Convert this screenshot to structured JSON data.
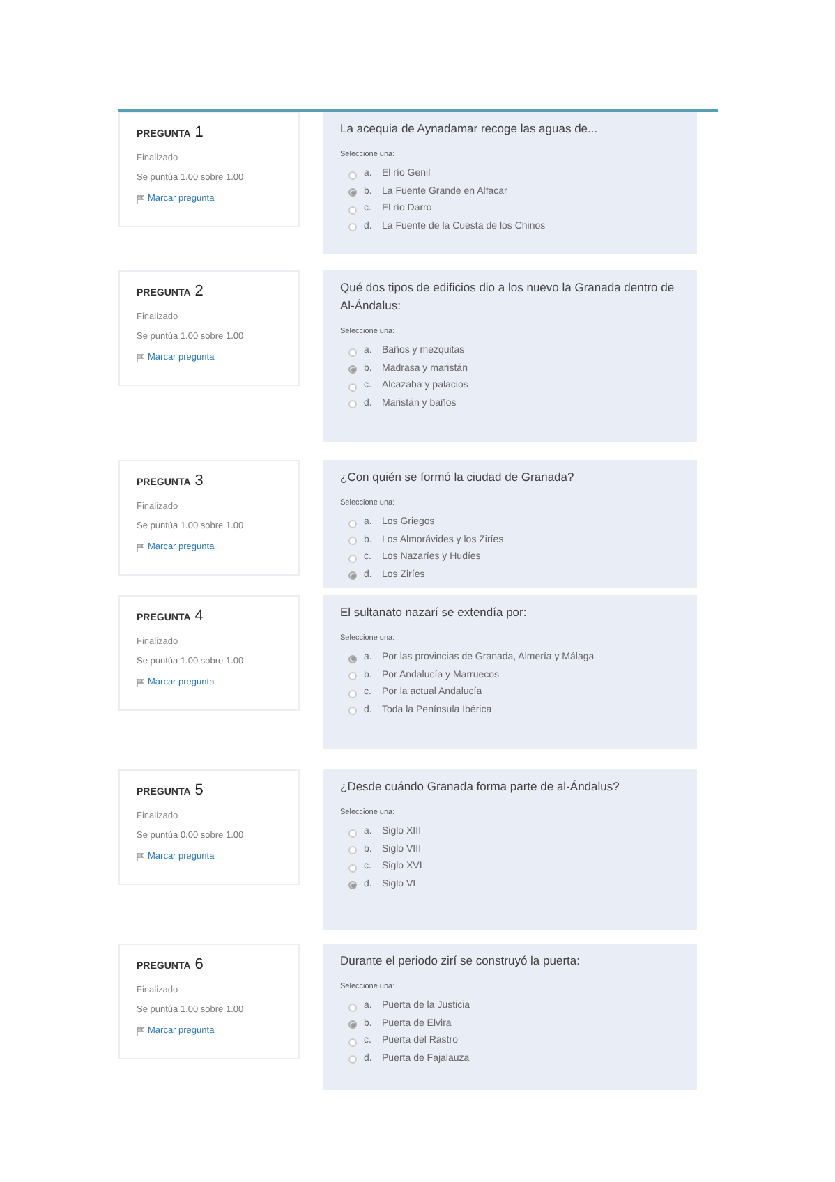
{
  "questions": [
    {
      "label": "PREGUNTA",
      "number": "1",
      "state": "Finalizado",
      "score": "Se puntúa 1.00 sobre 1.00",
      "flag": "Marcar pregunta",
      "prompt": "La acequia de Aynadamar recoge las aguas de...",
      "instruction": "Seleccione una:",
      "options": [
        {
          "letter": "a.",
          "text": "El río Genil",
          "selected": false
        },
        {
          "letter": "b.",
          "text": "La Fuente Grande en Alfacar",
          "selected": true
        },
        {
          "letter": "c.",
          "text": "El río Darro",
          "selected": false
        },
        {
          "letter": "d.",
          "text": "La Fuente de la Cuesta de los Chinos",
          "selected": false
        }
      ]
    },
    {
      "label": "PREGUNTA",
      "number": "2",
      "state": "Finalizado",
      "score": "Se puntúa 1.00 sobre 1.00",
      "flag": "Marcar pregunta",
      "prompt": "Qué dos tipos de edificios dio a los nuevo la Granada dentro de Al-Ándalus:",
      "instruction": "Seleccione una:",
      "options": [
        {
          "letter": "a.",
          "text": "Baños y mezquitas",
          "selected": false
        },
        {
          "letter": "b.",
          "text": "Madrasa y maristán",
          "selected": true
        },
        {
          "letter": "c.",
          "text": "Alcazaba y palacios",
          "selected": false
        },
        {
          "letter": "d.",
          "text": "Maristán y baños",
          "selected": false
        }
      ]
    },
    {
      "label": "PREGUNTA",
      "number": "3",
      "state": "Finalizado",
      "score": "Se puntúa 1.00 sobre 1.00",
      "flag": "Marcar pregunta",
      "prompt": "¿Con quién se formó la ciudad de Granada?",
      "instruction": "Seleccione una:",
      "options": [
        {
          "letter": "a.",
          "text": "Los Griegos",
          "selected": false
        },
        {
          "letter": "b.",
          "text": "Los Almorávides y los Ziríes",
          "selected": false
        },
        {
          "letter": "c.",
          "text": "Los Nazaríes y Hudíes",
          "selected": false
        },
        {
          "letter": "d.",
          "text": "Los Ziríes",
          "selected": true
        }
      ]
    },
    {
      "label": "PREGUNTA",
      "number": "4",
      "state": "Finalizado",
      "score": "Se puntúa 1.00 sobre 1.00",
      "flag": "Marcar pregunta",
      "prompt": "El sultanato nazarí se extendía por:",
      "instruction": "Seleccione una:",
      "options": [
        {
          "letter": "a.",
          "text": "Por las provincias de Granada, Almería y Málaga",
          "selected": true
        },
        {
          "letter": "b.",
          "text": "Por Andalucía y Marruecos",
          "selected": false
        },
        {
          "letter": "c.",
          "text": "Por la actual Andalucía",
          "selected": false
        },
        {
          "letter": "d.",
          "text": "Toda la Península Ibérica",
          "selected": false
        }
      ]
    },
    {
      "label": "PREGUNTA",
      "number": "5",
      "state": "Finalizado",
      "score": "Se puntúa 0.00 sobre 1.00",
      "flag": "Marcar pregunta",
      "prompt": "¿Desde cuándo Granada forma parte de al-Ándalus?",
      "instruction": "Seleccione una:",
      "options": [
        {
          "letter": "a.",
          "text": "Siglo XIII",
          "selected": false
        },
        {
          "letter": "b.",
          "text": "Siglo VIII",
          "selected": false
        },
        {
          "letter": "c.",
          "text": "Siglo XVI",
          "selected": false
        },
        {
          "letter": "d.",
          "text": "Siglo VI",
          "selected": true
        }
      ]
    },
    {
      "label": "PREGUNTA",
      "number": "6",
      "state": "Finalizado",
      "score": "Se puntúa 1.00 sobre 1.00",
      "flag": "Marcar pregunta",
      "prompt": "Durante el periodo zirí se construyó la puerta:",
      "instruction": "Seleccione una:",
      "options": [
        {
          "letter": "a.",
          "text": "Puerta de la Justicia",
          "selected": false
        },
        {
          "letter": "b.",
          "text": "Puerta de Elvira",
          "selected": true
        },
        {
          "letter": "c.",
          "text": "Puerta del Rastro",
          "selected": false
        },
        {
          "letter": "d.",
          "text": "Puerta de Fajalauza",
          "selected": false
        }
      ]
    }
  ]
}
